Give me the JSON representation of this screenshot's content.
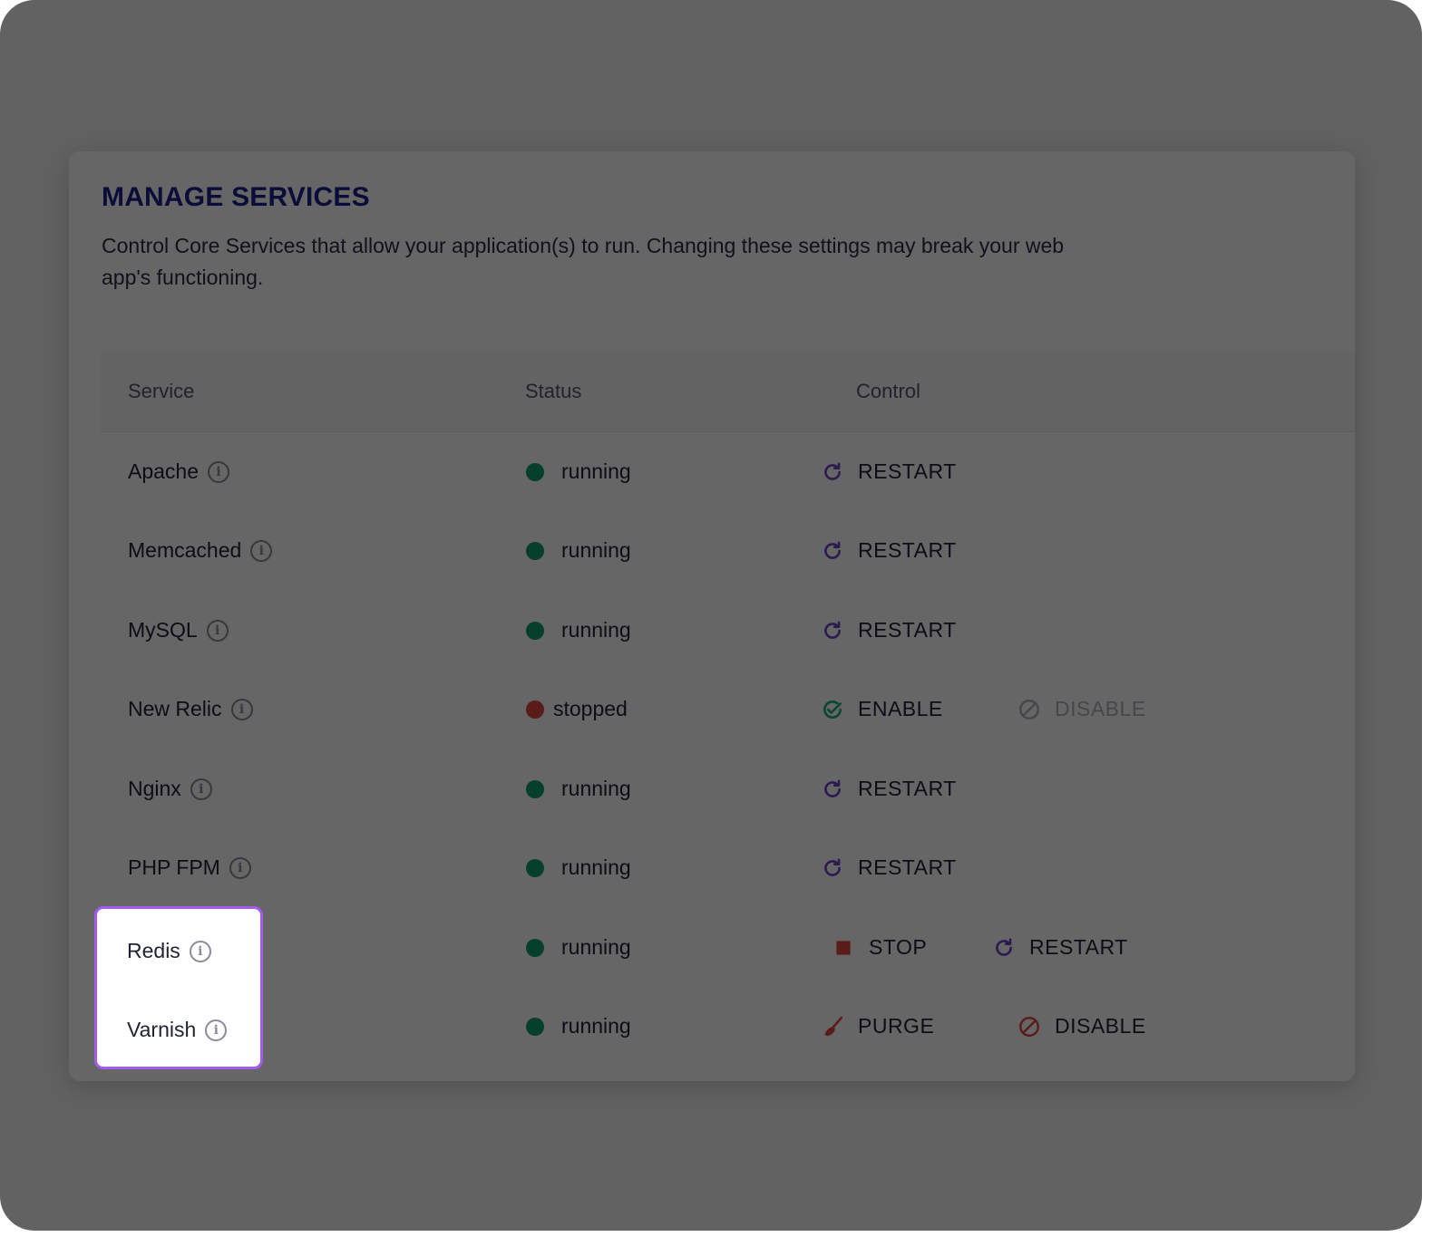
{
  "header": {
    "title": "MANAGE SERVICES",
    "subtitle": "Control Core Services that allow your application(s) to run. Changing these settings may break your web app's functioning."
  },
  "table": {
    "columns": [
      "Service",
      "Status",
      "Control"
    ],
    "rows": [
      {
        "name": "Apache",
        "status": "running",
        "controls": [
          {
            "label": "RESTART",
            "icon": "restart-icon"
          }
        ]
      },
      {
        "name": "Memcached",
        "status": "running",
        "controls": [
          {
            "label": "RESTART",
            "icon": "restart-icon"
          }
        ]
      },
      {
        "name": "MySQL",
        "status": "running",
        "controls": [
          {
            "label": "RESTART",
            "icon": "restart-icon"
          }
        ]
      },
      {
        "name": "New Relic",
        "status": "stopped",
        "controls": [
          {
            "label": "ENABLE",
            "icon": "check-circle-icon"
          },
          {
            "label": "DISABLE",
            "icon": "disable-icon",
            "disabled": true
          }
        ]
      },
      {
        "name": "Nginx",
        "status": "running",
        "controls": [
          {
            "label": "RESTART",
            "icon": "restart-icon"
          }
        ]
      },
      {
        "name": "PHP FPM",
        "status": "running",
        "controls": [
          {
            "label": "RESTART",
            "icon": "restart-icon"
          }
        ]
      },
      {
        "name": "Redis",
        "status": "running",
        "controls": [
          {
            "label": "STOP",
            "icon": "stop-icon"
          },
          {
            "label": "RESTART",
            "icon": "restart-icon"
          }
        ]
      },
      {
        "name": "Varnish",
        "status": "running",
        "controls": [
          {
            "label": "PURGE",
            "icon": "broom-icon"
          },
          {
            "label": "DISABLE",
            "icon": "disable-icon"
          }
        ]
      }
    ]
  },
  "colors": {
    "title": "#1c1f8a",
    "running": "#0f9d6b",
    "stopped": "#e2483d",
    "restart_icon": "#6b45c9",
    "enable_icon": "#19b07a",
    "danger": "#e2483d",
    "highlight_border": "#a25bf3"
  }
}
